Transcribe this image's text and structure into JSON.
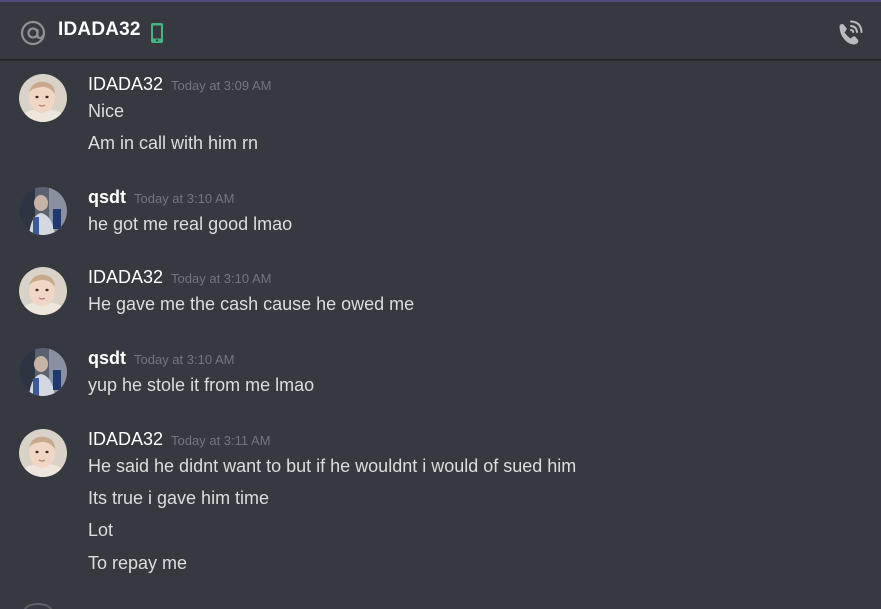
{
  "header": {
    "title": "IDADA32",
    "icons": {
      "mention": "at-sign-icon",
      "mobile": "mobile-phone-icon",
      "call": "start-voice-call-icon"
    },
    "colors": {
      "mobile_status": "#43b581",
      "accent": "#4f4d7d"
    }
  },
  "groups": [
    {
      "username": "IDADA32",
      "timestamp": "Today at 3:09 AM",
      "avatar": "baby-photo-avatar",
      "messages": [
        "Nice",
        "Am in call with him rn"
      ]
    },
    {
      "username": "qsdt",
      "timestamp": "Today at 3:10 AM",
      "avatar": "person-photo-avatar",
      "messages": [
        "he got me real good lmao"
      ]
    },
    {
      "username": "IDADA32",
      "timestamp": "Today at 3:10 AM",
      "avatar": "baby-photo-avatar",
      "messages": [
        "He gave me the cash cause he owed me"
      ]
    },
    {
      "username": "qsdt",
      "timestamp": "Today at 3:10 AM",
      "avatar": "person-photo-avatar",
      "messages": [
        "yup he stole it from me lmao"
      ]
    },
    {
      "username": "IDADA32",
      "timestamp": "Today at 3:11 AM",
      "avatar": "baby-photo-avatar",
      "messages": [
        "He said he didnt want to but if he wouldnt i would of sued him",
        "Its true i gave him time",
        "Lot",
        "To repay me"
      ]
    }
  ]
}
